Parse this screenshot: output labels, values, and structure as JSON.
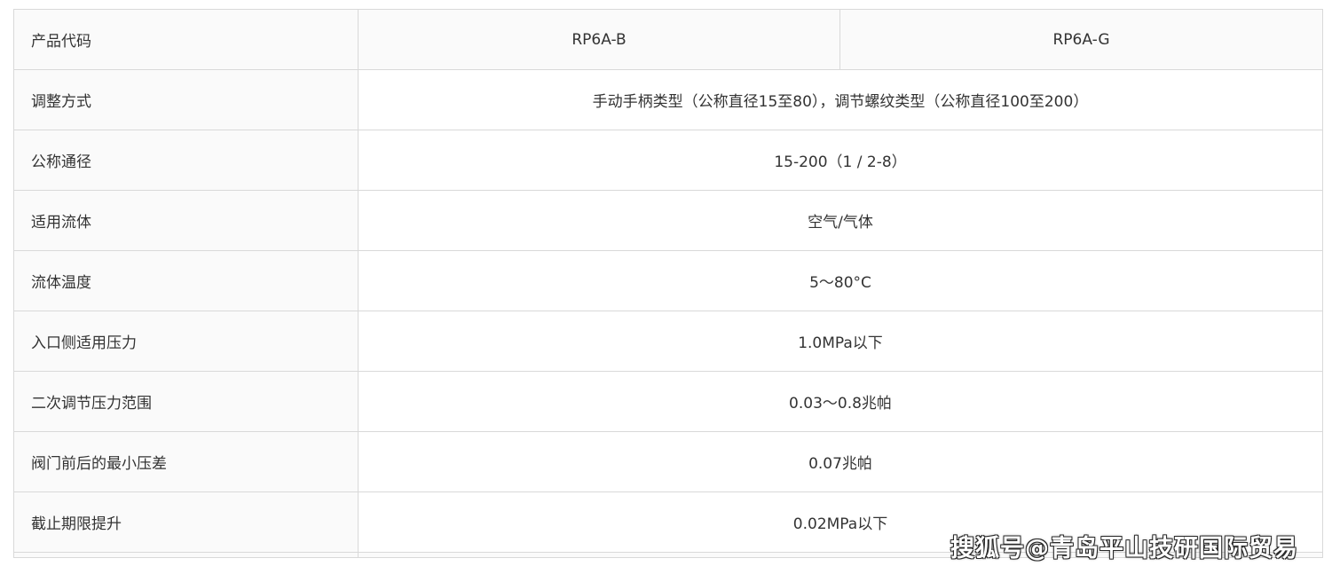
{
  "table": {
    "header": {
      "label": "产品代码",
      "col_b": "RP6A-B",
      "col_g": "RP6A-G"
    },
    "rows": [
      {
        "label": "调整方式",
        "value": "手动手柄类型（公称直径15至80），调节螺纹类型（公称直径100至200）"
      },
      {
        "label": "公称通径",
        "value": "15-200（1 / 2-8）"
      },
      {
        "label": "适用流体",
        "value": "空气/气体"
      },
      {
        "label": "流体温度",
        "value": "5～80°C"
      },
      {
        "label": "入口侧适用压力",
        "value": "1.0MPa以下"
      },
      {
        "label": "二次调节压力范围",
        "value": "0.03～0.8兆帕"
      },
      {
        "label": "阀门前后的最小压差",
        "value": "0.07兆帕"
      },
      {
        "label": "截止期限提升",
        "value": "0.02MPa以下"
      }
    ]
  },
  "watermark": "搜狐号@青岛平山技研国际贸易"
}
